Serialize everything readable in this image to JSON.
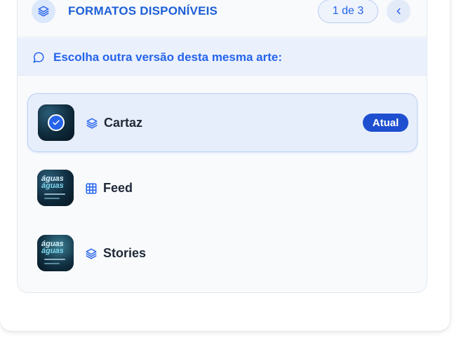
{
  "header": {
    "title": "FORMATOS DISPONÍVEIS",
    "counter": "1 de 3",
    "icon": "layers-icon",
    "prev_icon": "chevron-left-icon"
  },
  "hint": {
    "text": "Escolha outra versão desta mesma arte:",
    "icon": "message-circle-icon"
  },
  "formats": [
    {
      "label": "Cartaz",
      "icon": "layers-icon",
      "active": true,
      "badge": "Atual",
      "thumb_text": [
        "",
        ""
      ]
    },
    {
      "label": "Feed",
      "icon": "grid-icon",
      "active": false,
      "thumb_text": [
        "águas",
        "águas"
      ]
    },
    {
      "label": "Stories",
      "icon": "layers-icon",
      "active": false,
      "thumb_text": [
        "águas",
        "águas"
      ]
    }
  ],
  "colors": {
    "accent": "#2563eb",
    "badge_bg": "#1d4fd0",
    "active_row_bg": "#e7eefb"
  }
}
